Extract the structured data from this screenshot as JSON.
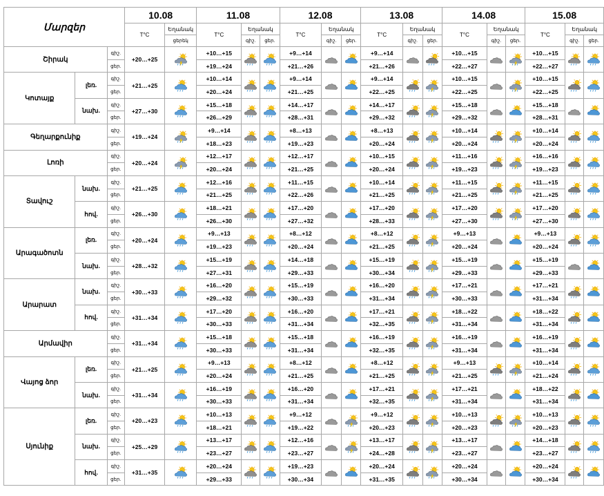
{
  "header": {
    "region_title": "Մարզեր",
    "temp_label": "T°C",
    "weather_label": "Եղանակ",
    "day_label": "ցերեկ",
    "night_label": "գիշ.",
    "day_short": "ցեր.",
    "dates": [
      "10.08",
      "11.08",
      "12.08",
      "13.08",
      "14.08",
      "15.08"
    ]
  },
  "labels": {
    "night": "գիշ.",
    "day": "ցեր."
  },
  "icon_legend": {
    "p": "partly-cloudy-rain-icon",
    "c": "cloud-sun-icon",
    "s": "sun-cloud-rain-icon",
    "g": "overcast-cloud-icon",
    "b": "sun-cloud-icon",
    "r": "rain-cloud-sun-icon"
  },
  "regions": [
    {
      "name": "Շիրակ",
      "subs": [
        {
          "label": "",
          "day0": {
            "temp": "+20…+25",
            "icon": "p"
          },
          "days": [
            {
              "n": "+10…+15",
              "d": "+19…+24",
              "i1": "c",
              "i2": "s"
            },
            {
              "n": "+9…+14",
              "d": "+21…+26",
              "i1": "g",
              "i2": "b"
            },
            {
              "n": "+9…+14",
              "d": "+21…+26",
              "i1": "g",
              "i2": "r"
            },
            {
              "n": "+10…+15",
              "d": "+22…+27",
              "i1": "g",
              "i2": "p"
            },
            {
              "n": "+10…+15",
              "d": "+22…+27",
              "i1": "c",
              "i2": "s"
            }
          ]
        }
      ]
    },
    {
      "name": "Կոտայք",
      "subs": [
        {
          "label": "լեռ.",
          "day0": {
            "temp": "+21…+25",
            "icon": "s"
          },
          "days": [
            {
              "n": "+10…+14",
              "d": "+20…+24",
              "i1": "c",
              "i2": "s"
            },
            {
              "n": "+9…+14",
              "d": "+21…+25",
              "i1": "g",
              "i2": "b"
            },
            {
              "n": "+9…+14",
              "d": "+22…+25",
              "i1": "r",
              "i2": "p"
            },
            {
              "n": "+10…+15",
              "d": "+22…+25",
              "i1": "g",
              "i2": "p"
            },
            {
              "n": "+10…+15",
              "d": "+22…+25",
              "i1": "r",
              "i2": "s"
            }
          ]
        },
        {
          "label": "նախ.",
          "day0": {
            "temp": "+27…+30",
            "icon": "s"
          },
          "days": [
            {
              "n": "+15…+18",
              "d": "+26…+29",
              "i1": "c",
              "i2": "s"
            },
            {
              "n": "+14…+17",
              "d": "+28…+31",
              "i1": "g",
              "i2": "b"
            },
            {
              "n": "+14…+17",
              "d": "+29…+32",
              "i1": "r",
              "i2": "p"
            },
            {
              "n": "+15…+18",
              "d": "+29…+32",
              "i1": "g",
              "i2": "b"
            },
            {
              "n": "+15…+18",
              "d": "+28…+31",
              "i1": "g",
              "i2": "b"
            }
          ]
        }
      ]
    },
    {
      "name": "Գեղարքունիք",
      "subs": [
        {
          "label": "",
          "day0": {
            "temp": "+19…+24",
            "icon": "p"
          },
          "days": [
            {
              "n": "+9…+14",
              "d": "+18…+23",
              "i1": "c",
              "i2": "s"
            },
            {
              "n": "+8…+13",
              "d": "+19…+23",
              "i1": "g",
              "i2": "b"
            },
            {
              "n": "+8…+13",
              "d": "+20…+24",
              "i1": "r",
              "i2": "p"
            },
            {
              "n": "+10…+14",
              "d": "+20…+24",
              "i1": "r",
              "i2": "p"
            },
            {
              "n": "+10…+14",
              "d": "+20…+24",
              "i1": "r",
              "i2": "s"
            }
          ]
        }
      ]
    },
    {
      "name": "Լոռի",
      "subs": [
        {
          "label": "",
          "day0": {
            "temp": "+20…+24",
            "icon": "p"
          },
          "days": [
            {
              "n": "+12…+17",
              "d": "+20…+24",
              "i1": "c",
              "i2": "s"
            },
            {
              "n": "+12…+17",
              "d": "+21…+25",
              "i1": "g",
              "i2": "b"
            },
            {
              "n": "+10…+15",
              "d": "+20…+24",
              "i1": "r",
              "i2": "p"
            },
            {
              "n": "+11…+16",
              "d": "+19…+23",
              "i1": "r",
              "i2": "p"
            },
            {
              "n": "+16…+16",
              "d": "+19…+23",
              "i1": "r",
              "i2": "s"
            }
          ]
        }
      ]
    },
    {
      "name": "Տավուշ",
      "subs": [
        {
          "label": "նախ.",
          "day0": {
            "temp": "+21…+25",
            "icon": "s"
          },
          "days": [
            {
              "n": "+12…+16",
              "d": "+21…+25",
              "i1": "c",
              "i2": "s"
            },
            {
              "n": "+11…+15",
              "d": "+22…+26",
              "i1": "g",
              "i2": "b"
            },
            {
              "n": "+10…+14",
              "d": "+21…+25",
              "i1": "r",
              "i2": "p"
            },
            {
              "n": "+11…+15",
              "d": "+21…+25",
              "i1": "r",
              "i2": "p"
            },
            {
              "n": "+11…+15",
              "d": "+21…+25",
              "i1": "r",
              "i2": "s"
            }
          ]
        },
        {
          "label": "հով.",
          "day0": {
            "temp": "+26…+30",
            "icon": "s"
          },
          "days": [
            {
              "n": "+18…+21",
              "d": "+26…+30",
              "i1": "c",
              "i2": "s"
            },
            {
              "n": "+17…+20",
              "d": "+27…+32",
              "i1": "g",
              "i2": "b"
            },
            {
              "n": "+17…+20",
              "d": "+28…+33",
              "i1": "r",
              "i2": "p"
            },
            {
              "n": "+17…+20",
              "d": "+27…+30",
              "i1": "r",
              "i2": "p"
            },
            {
              "n": "+17…+20",
              "d": "+27…+30",
              "i1": "r",
              "i2": "s"
            }
          ]
        }
      ]
    },
    {
      "name": "Արագածոտն",
      "subs": [
        {
          "label": "լեռ.",
          "day0": {
            "temp": "+20…+24",
            "icon": "s"
          },
          "days": [
            {
              "n": "+9…+13",
              "d": "+19…+23",
              "i1": "c",
              "i2": "s"
            },
            {
              "n": "+8…+12",
              "d": "+20…+24",
              "i1": "g",
              "i2": "b"
            },
            {
              "n": "+8…+12",
              "d": "+21…+25",
              "i1": "r",
              "i2": "p"
            },
            {
              "n": "+9…+13",
              "d": "+20…+24",
              "i1": "g",
              "i2": "b"
            },
            {
              "n": "+9…+13",
              "d": "+20…+24",
              "i1": "r",
              "i2": "s"
            }
          ]
        },
        {
          "label": "նախ.",
          "day0": {
            "temp": "+28…+32",
            "icon": "s"
          },
          "days": [
            {
              "n": "+15…+19",
              "d": "+27…+31",
              "i1": "c",
              "i2": "s"
            },
            {
              "n": "+14…+18",
              "d": "+29…+33",
              "i1": "g",
              "i2": "b"
            },
            {
              "n": "+15…+19",
              "d": "+30…+34",
              "i1": "r",
              "i2": "p"
            },
            {
              "n": "+15…+19",
              "d": "+29…+33",
              "i1": "g",
              "i2": "b"
            },
            {
              "n": "+15…+19",
              "d": "+29…+33",
              "i1": "g",
              "i2": "b"
            }
          ]
        }
      ]
    },
    {
      "name": "Արարատ",
      "subs": [
        {
          "label": "նախ.",
          "day0": {
            "temp": "+30…+33",
            "icon": "s"
          },
          "days": [
            {
              "n": "+16…+20",
              "d": "+29…+32",
              "i1": "c",
              "i2": "s"
            },
            {
              "n": "+15…+19",
              "d": "+30…+33",
              "i1": "g",
              "i2": "b"
            },
            {
              "n": "+16…+20",
              "d": "+31…+34",
              "i1": "r",
              "i2": "p"
            },
            {
              "n": "+17…+21",
              "d": "+30…+33",
              "i1": "g",
              "i2": "b"
            },
            {
              "n": "+17…+21",
              "d": "+31…+34",
              "i1": "r",
              "i2": "b"
            }
          ]
        },
        {
          "label": "հով.",
          "day0": {
            "temp": "+31…+34",
            "icon": "s"
          },
          "days": [
            {
              "n": "+17…+20",
              "d": "+30…+33",
              "i1": "c",
              "i2": "s"
            },
            {
              "n": "+16…+20",
              "d": "+31…+34",
              "i1": "g",
              "i2": "b"
            },
            {
              "n": "+17…+21",
              "d": "+32…+35",
              "i1": "r",
              "i2": "p"
            },
            {
              "n": "+18…+22",
              "d": "+31…+34",
              "i1": "g",
              "i2": "b"
            },
            {
              "n": "+18…+22",
              "d": "+31…+34",
              "i1": "r",
              "i2": "b"
            }
          ]
        }
      ]
    },
    {
      "name": "Արմավիր",
      "subs": [
        {
          "label": "",
          "day0": {
            "temp": "+31…+34",
            "icon": "s"
          },
          "days": [
            {
              "n": "+15…+18",
              "d": "+30…+33",
              "i1": "c",
              "i2": "s"
            },
            {
              "n": "+15…+18",
              "d": "+31…+34",
              "i1": "g",
              "i2": "b"
            },
            {
              "n": "+16…+19",
              "d": "+32…+35",
              "i1": "r",
              "i2": "p"
            },
            {
              "n": "+16…+19",
              "d": "+31…+34",
              "i1": "g",
              "i2": "b"
            },
            {
              "n": "+16…+19",
              "d": "+31…+34",
              "i1": "r",
              "i2": "b"
            }
          ]
        }
      ]
    },
    {
      "name": "Վայոց ձոր",
      "subs": [
        {
          "label": "լեռ.",
          "day0": {
            "temp": "+21…+25",
            "icon": "s"
          },
          "days": [
            {
              "n": "+9…+13",
              "d": "+20…+24",
              "i1": "c",
              "i2": "s"
            },
            {
              "n": "+8…+12",
              "d": "+21…+25",
              "i1": "g",
              "i2": "b"
            },
            {
              "n": "+8…+12",
              "d": "+21…+25",
              "i1": "r",
              "i2": "p"
            },
            {
              "n": "+9…+13",
              "d": "+21…+25",
              "i1": "r",
              "i2": "p"
            },
            {
              "n": "+10…+14",
              "d": "+21…+24",
              "i1": "r",
              "i2": "s"
            }
          ]
        },
        {
          "label": "նախ.",
          "day0": {
            "temp": "+31…+34",
            "icon": "s"
          },
          "days": [
            {
              "n": "+16…+19",
              "d": "+30…+33",
              "i1": "c",
              "i2": "s"
            },
            {
              "n": "+16…+20",
              "d": "+31…+34",
              "i1": "g",
              "i2": "b"
            },
            {
              "n": "+17…+21",
              "d": "+32…+35",
              "i1": "r",
              "i2": "p"
            },
            {
              "n": "+17…+21",
              "d": "+31…+34",
              "i1": "g",
              "i2": "b"
            },
            {
              "n": "+18…+22",
              "d": "+31…+34",
              "i1": "r",
              "i2": "b"
            }
          ]
        }
      ]
    },
    {
      "name": "Սյունիք",
      "subs": [
        {
          "label": "լեռ.",
          "day0": {
            "temp": "+20…+23",
            "icon": "s"
          },
          "days": [
            {
              "n": "+10…+13",
              "d": "+18…+21",
              "i1": "c",
              "i2": "s"
            },
            {
              "n": "+9…+12",
              "d": "+19…+22",
              "i1": "g",
              "i2": "p"
            },
            {
              "n": "+9…+12",
              "d": "+20…+23",
              "i1": "r",
              "i2": "p"
            },
            {
              "n": "+10…+13",
              "d": "+20…+23",
              "i1": "r",
              "i2": "p"
            },
            {
              "n": "+10…+13",
              "d": "+20…+23",
              "i1": "r",
              "i2": "s"
            }
          ]
        },
        {
          "label": "նախ.",
          "day0": {
            "temp": "+25…+29",
            "icon": "s"
          },
          "days": [
            {
              "n": "+13…+17",
              "d": "+23…+27",
              "i1": "c",
              "i2": "s"
            },
            {
              "n": "+12…+16",
              "d": "+23…+27",
              "i1": "g",
              "i2": "p"
            },
            {
              "n": "+13…+17",
              "d": "+24…+28",
              "i1": "r",
              "i2": "p"
            },
            {
              "n": "+13…+17",
              "d": "+23…+27",
              "i1": "g",
              "i2": "b"
            },
            {
              "n": "+14…+18",
              "d": "+23…+27",
              "i1": "r",
              "i2": "s"
            }
          ]
        },
        {
          "label": "հով.",
          "day0": {
            "temp": "+31…+35",
            "icon": "s"
          },
          "days": [
            {
              "n": "+20…+24",
              "d": "+29…+33",
              "i1": "c",
              "i2": "s"
            },
            {
              "n": "+19…+23",
              "d": "+30…+34",
              "i1": "g",
              "i2": "b"
            },
            {
              "n": "+20…+24",
              "d": "+31…+35",
              "i1": "r",
              "i2": "p"
            },
            {
              "n": "+20…+24",
              "d": "+30…+34",
              "i1": "g",
              "i2": "b"
            },
            {
              "n": "+20…+24",
              "d": "+30…+34",
              "i1": "r",
              "i2": "b"
            }
          ]
        }
      ]
    }
  ]
}
